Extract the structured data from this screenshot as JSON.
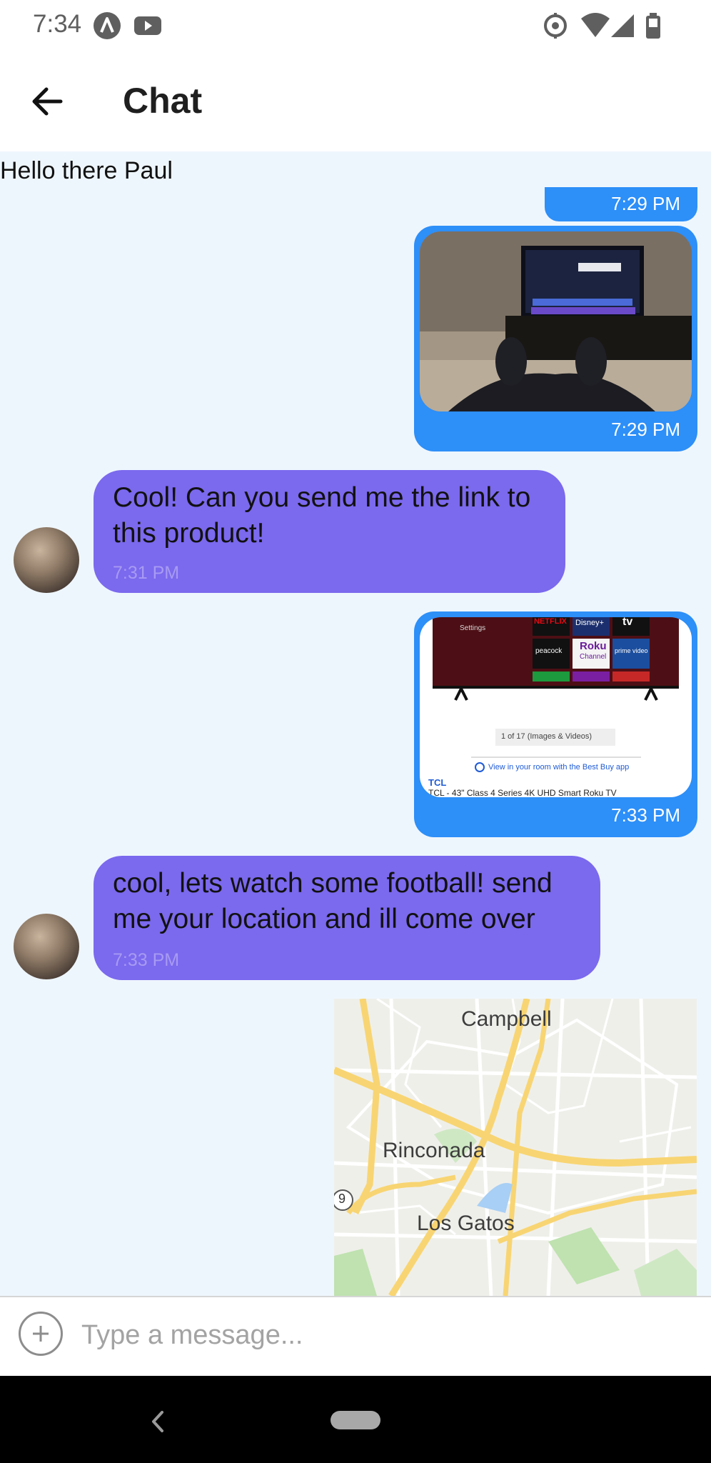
{
  "status_bar": {
    "time": "7:34",
    "icons": [
      "app-a-icon",
      "youtube-icon",
      "location-icon",
      "wifi-icon",
      "signal-icon",
      "battery-icon"
    ]
  },
  "header": {
    "title": "Chat",
    "back_icon": "arrow-left-icon"
  },
  "chat": {
    "system_text": "Hello there Paul",
    "messages": [
      {
        "type": "outgoing-partial",
        "time": "7:29 PM"
      },
      {
        "type": "outgoing-image",
        "image": "living room tv photo",
        "time": "7:29 PM"
      },
      {
        "type": "incoming",
        "text": "Cool! Can you send me the link to this product!",
        "time": "7:31 PM"
      },
      {
        "type": "outgoing-link",
        "time": "7:33 PM",
        "link": {
          "tiles": [
            "NETFLIX",
            "Disney+",
            "tv",
            "peacock",
            "Roku",
            "Channel",
            "prime video"
          ],
          "settings": "Settings",
          "gallery_count": "1 of 17 (Images & Videos)",
          "view_in_room": "View in your room with the Best Buy app",
          "brand": "TCL",
          "product": "TCL - 43\" Class 4 Series 4K UHD Smart Roku TV"
        }
      },
      {
        "type": "incoming",
        "text": "cool, lets watch some football! send me your location and ill come over",
        "time": "7:33 PM"
      },
      {
        "type": "outgoing-map",
        "labels": [
          "Campbell",
          "Rinconada",
          "Los Gatos",
          "9"
        ]
      }
    ]
  },
  "composer": {
    "add_icon": "plus-circle-icon",
    "placeholder": "Type a message..."
  },
  "colors": {
    "outgoing": "#2d8ff8",
    "incoming": "#7b69ee",
    "chat_bg": "#eef6fd"
  }
}
